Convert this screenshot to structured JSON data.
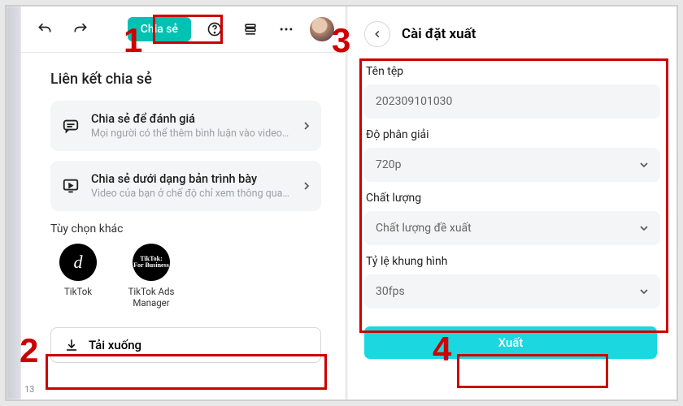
{
  "left": {
    "share_button": "Chia sẻ",
    "share_heading": "Liên kết chia sẻ",
    "opt1_title": "Chia sẻ để đánh giá",
    "opt1_sub": "Mọi người có thể thêm bình luận vào video…",
    "opt2_title": "Chia sẻ dưới dạng bản trình bày",
    "opt2_sub": "Video của bạn ở chế độ chỉ xem thông qua…",
    "other_heading": "Tùy chọn khác",
    "tile1": "TikTok",
    "tile2": "TikTok Ads Manager",
    "download": "Tải xuống",
    "timecode": "13"
  },
  "right": {
    "title": "Cài đặt xuất",
    "filename_label": "Tên tệp",
    "filename_value": "202309101030",
    "resolution_label": "Độ phân giải",
    "resolution_value": "720p",
    "quality_label": "Chất lượng",
    "quality_value": "Chất lượng đề xuất",
    "fps_label": "Tỷ lệ khung hình",
    "fps_value": "30fps",
    "export_button": "Xuất"
  },
  "annotations": {
    "n1": "1",
    "n2": "2",
    "n3": "3",
    "n4": "4"
  }
}
